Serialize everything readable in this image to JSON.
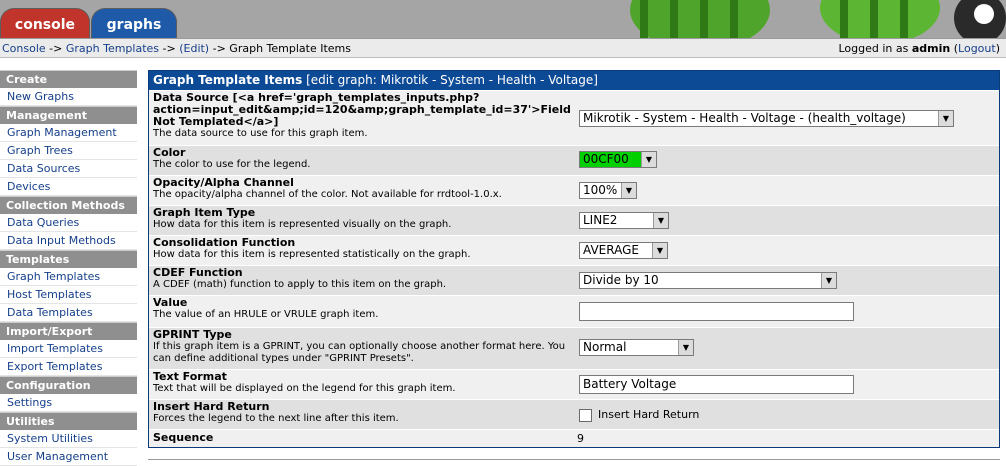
{
  "tabs": {
    "console": "console",
    "graphs": "graphs"
  },
  "breadcrumb": {
    "console": "Console",
    "sep1": " -> ",
    "templates": "Graph Templates",
    "sep2": " -> ",
    "edit": "(Edit)",
    "sep3": " -> ",
    "current": "Graph Template Items"
  },
  "login": {
    "prefix": "Logged in as ",
    "user": "admin",
    "open": " (",
    "logout": "Logout",
    "close": ")"
  },
  "sidebar": [
    {
      "type": "head",
      "label": "Create"
    },
    {
      "type": "item",
      "label": "New Graphs"
    },
    {
      "type": "head",
      "label": "Management"
    },
    {
      "type": "item",
      "label": "Graph Management"
    },
    {
      "type": "item",
      "label": "Graph Trees"
    },
    {
      "type": "item",
      "label": "Data Sources"
    },
    {
      "type": "item",
      "label": "Devices"
    },
    {
      "type": "head",
      "label": "Collection Methods"
    },
    {
      "type": "item",
      "label": "Data Queries"
    },
    {
      "type": "item",
      "label": "Data Input Methods"
    },
    {
      "type": "head",
      "label": "Templates"
    },
    {
      "type": "item",
      "label": "Graph Templates"
    },
    {
      "type": "item",
      "label": "Host Templates"
    },
    {
      "type": "item",
      "label": "Data Templates"
    },
    {
      "type": "head",
      "label": "Import/Export"
    },
    {
      "type": "item",
      "label": "Import Templates"
    },
    {
      "type": "item",
      "label": "Export Templates"
    },
    {
      "type": "head",
      "label": "Configuration"
    },
    {
      "type": "item",
      "label": "Settings"
    },
    {
      "type": "head",
      "label": "Utilities"
    },
    {
      "type": "item",
      "label": "System Utilities"
    },
    {
      "type": "item",
      "label": "User Management"
    }
  ],
  "panel": {
    "title": "Graph Template Items",
    "subtitle": " [edit graph: Mikrotik - System - Health - Voltage]"
  },
  "form": {
    "data_source": {
      "label": "Data Source [<a href='graph_templates_inputs.php?action=input_edit&amp;id=120&amp;graph_template_id=37'>Field Not Templated</a>]",
      "desc": "The data source to use for this graph item.",
      "value": "Mikrotik - System - Health - Voltage - (health_voltage)"
    },
    "color": {
      "label": "Color",
      "desc": "The color to use for the legend.",
      "value": "00CF00",
      "swatch": "#00cf00"
    },
    "opacity": {
      "label": "Opacity/Alpha Channel",
      "desc": "The opacity/alpha channel of the color. Not available for rrdtool-1.0.x.",
      "value": "100%"
    },
    "item_type": {
      "label": "Graph Item Type",
      "desc": "How data for this item is represented visually on the graph.",
      "value": "LINE2"
    },
    "consolidation": {
      "label": "Consolidation Function",
      "desc": "How data for this item is represented statistically on the graph.",
      "value": "AVERAGE"
    },
    "cdef": {
      "label": "CDEF Function",
      "desc": "A CDEF (math) function to apply to this item on the graph.",
      "value": "Divide by 10"
    },
    "value": {
      "label": "Value",
      "desc": "The value of an HRULE or VRULE graph item.",
      "value": ""
    },
    "gprint": {
      "label": "GPRINT Type",
      "desc": "If this graph item is a GPRINT, you can optionally choose another format here. You can define additional types under \"GPRINT Presets\".",
      "value": "Normal"
    },
    "text_format": {
      "label": "Text Format",
      "desc": "Text that will be displayed on the legend for this graph item.",
      "value": "Battery Voltage"
    },
    "hard_return": {
      "label": "Insert Hard Return",
      "desc": "Forces the legend to the next line after this item.",
      "checkbox_label": "Insert Hard Return"
    },
    "sequence": {
      "label": "Sequence",
      "value": "9"
    }
  }
}
